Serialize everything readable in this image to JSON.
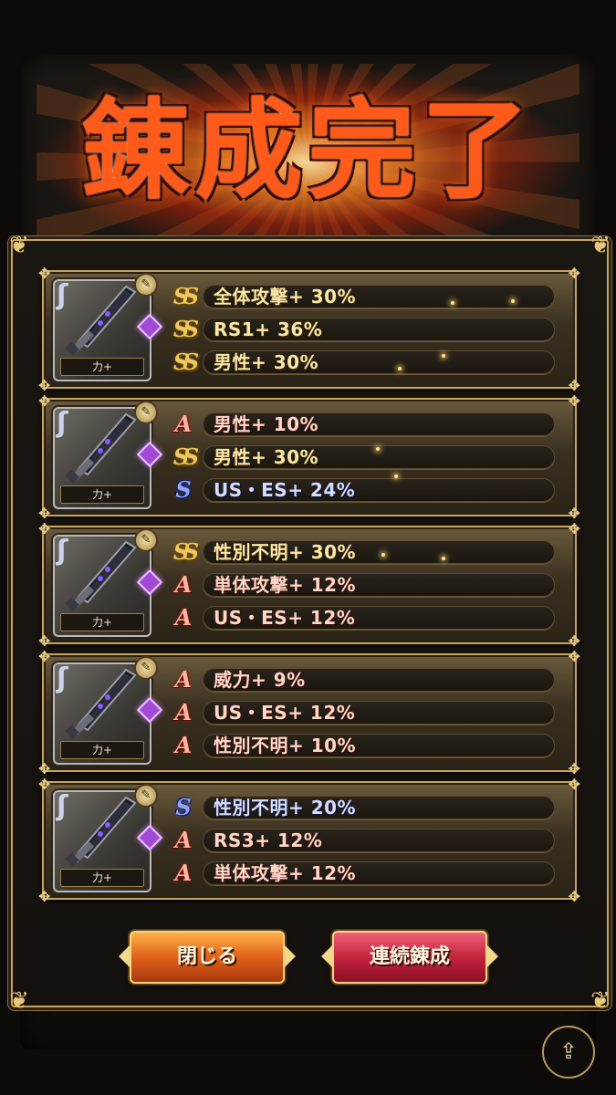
{
  "title": "錬成完了",
  "cards": [
    {
      "weapon_label": "力+",
      "rows": [
        {
          "rank": "SS",
          "text": "全体攻撃+ 30%",
          "tone": "gold"
        },
        {
          "rank": "SS",
          "text": "RS1+ 36%",
          "tone": "gold"
        },
        {
          "rank": "SS",
          "text": "男性+ 30%",
          "tone": "gold"
        }
      ]
    },
    {
      "weapon_label": "力+",
      "rows": [
        {
          "rank": "A",
          "text": "男性+ 10%",
          "tone": "pink"
        },
        {
          "rank": "SS",
          "text": "男性+ 30%",
          "tone": "gold"
        },
        {
          "rank": "S",
          "text": "US・ES+ 24%",
          "tone": "blue"
        }
      ]
    },
    {
      "weapon_label": "力+",
      "rows": [
        {
          "rank": "SS",
          "text": "性別不明+ 30%",
          "tone": "gold"
        },
        {
          "rank": "A",
          "text": "単体攻撃+ 12%",
          "tone": "pink"
        },
        {
          "rank": "A",
          "text": "US・ES+ 12%",
          "tone": "pink"
        }
      ]
    },
    {
      "weapon_label": "力+",
      "rows": [
        {
          "rank": "A",
          "text": "威力+ 9%",
          "tone": "pink"
        },
        {
          "rank": "A",
          "text": "US・ES+ 12%",
          "tone": "pink"
        },
        {
          "rank": "A",
          "text": "性別不明+ 10%",
          "tone": "pink"
        }
      ]
    },
    {
      "weapon_label": "力+",
      "rows": [
        {
          "rank": "S",
          "text": "性別不明+ 20%",
          "tone": "blue"
        },
        {
          "rank": "A",
          "text": "RS3+ 12%",
          "tone": "pink"
        },
        {
          "rank": "A",
          "text": "単体攻撃+ 12%",
          "tone": "pink"
        }
      ]
    }
  ],
  "buttons": {
    "close_label": "閉じる",
    "continue_label": "連続錬成"
  },
  "colors": {
    "gold_text": "#fbe7a4",
    "a_rank": "#ffb4a0",
    "s_rank": "#8ea2ff",
    "ss_rank": "#f0c85a",
    "frame": "#c9a45c"
  },
  "icons": {
    "share": "share-icon",
    "weapon": "sword-icon",
    "gem": "gem-icon"
  }
}
